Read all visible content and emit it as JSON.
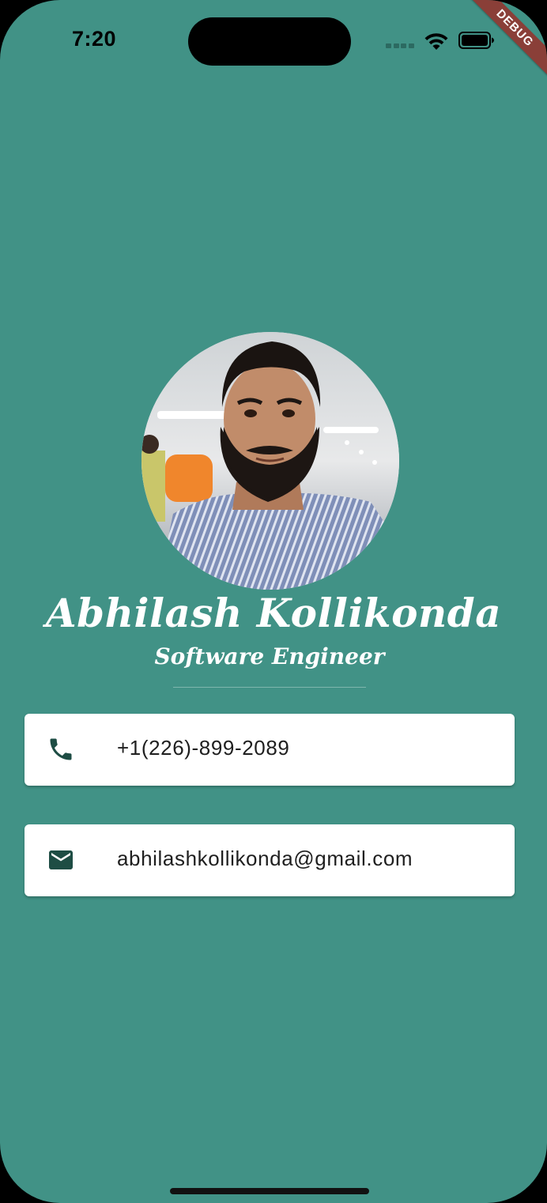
{
  "status_bar": {
    "time": "7:20"
  },
  "debug_banner": {
    "label": "DEBUG"
  },
  "profile": {
    "name": "Abhilash Kollikonda",
    "title": "Software Engineer"
  },
  "contacts": {
    "phone": {
      "icon": "phone-icon",
      "value": "+1(226)-899-2089"
    },
    "email": {
      "icon": "email-icon",
      "value": "abhilashkollikonda@gmail.com"
    }
  },
  "colors": {
    "background": "#419286",
    "card": "#ffffff",
    "icon": "#1e4d44",
    "debug_banner": "#8a3f38"
  }
}
